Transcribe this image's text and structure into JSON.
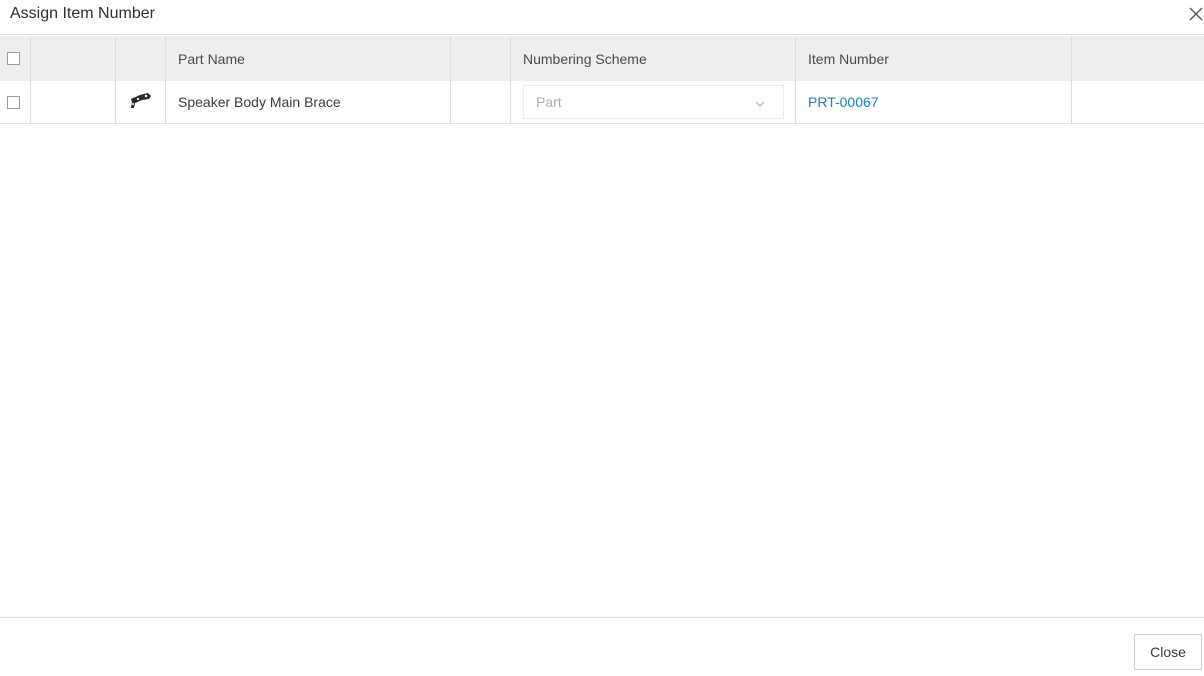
{
  "dialog": {
    "title": "Assign Item Number",
    "close_icon": "close-icon"
  },
  "table": {
    "columns": [
      "",
      "",
      "",
      "Part Name",
      "",
      "Numbering Scheme",
      "Item Number",
      ""
    ],
    "rows": [
      {
        "checked": false,
        "icon": "part-brace-icon",
        "part_name": "Speaker Body Main Brace",
        "numbering_scheme": "Part",
        "item_number": "PRT-00067"
      }
    ]
  },
  "footer": {
    "close_label": "Close"
  },
  "colors": {
    "link": "#1f7fb3",
    "header_bg": "#eeeeee"
  }
}
